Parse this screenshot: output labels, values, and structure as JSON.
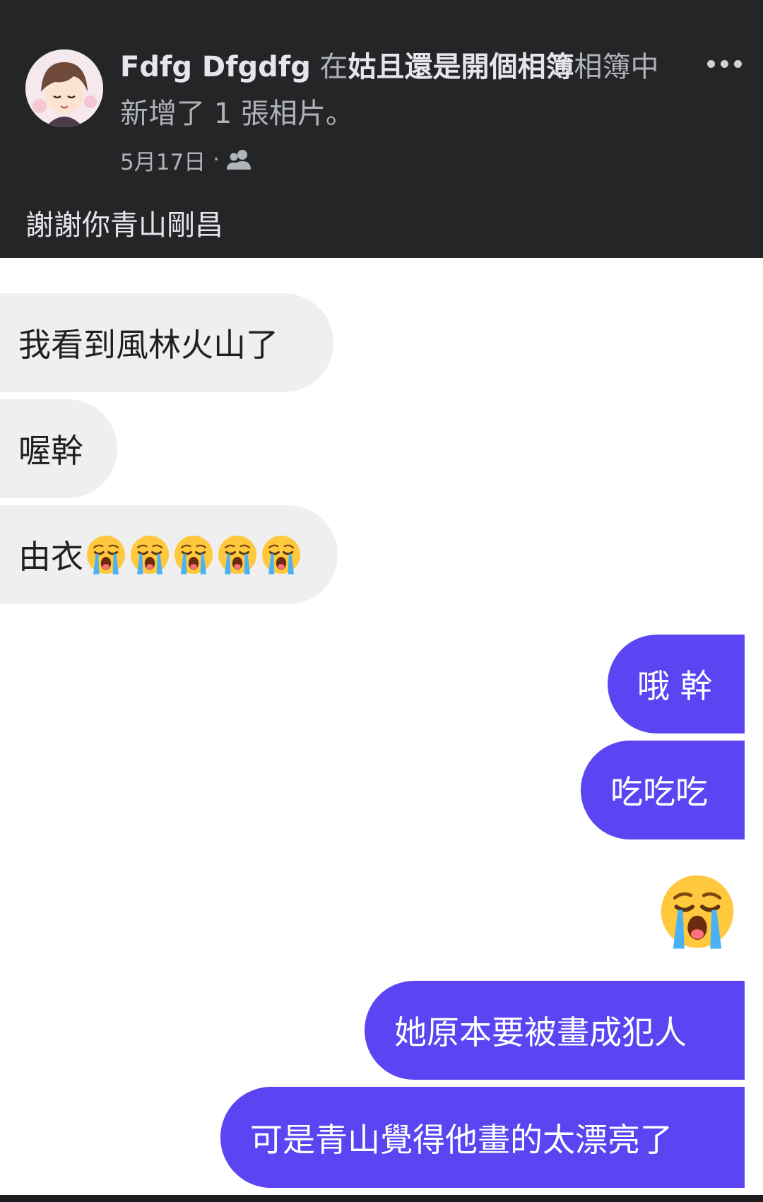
{
  "post": {
    "author_name": "Fdfg Dfgdfg",
    "action_prefix": " 在",
    "album_name": "姑且還是開個相簿",
    "action_suffix": "相簿中新增了 1 張相片。",
    "date": "5月17日",
    "separator": " · ",
    "audience_icon": "friends-icon",
    "more_icon": "more-options-icon",
    "caption": "謝謝你青山剛昌"
  },
  "chat": {
    "incoming": [
      {
        "text": "我看到風林火山了"
      },
      {
        "text": "喔幹"
      },
      {
        "text": "由衣",
        "emoji": "loudly-crying-face",
        "emoji_count": 5
      }
    ],
    "outgoing": [
      {
        "text": "哦 幹"
      },
      {
        "text": "吃吃吃"
      },
      {
        "emoji": "loudly-crying-face"
      },
      {
        "text": "她原本要被畫成犯人"
      },
      {
        "text": "可是青山覺得他畫的太漂亮了"
      }
    ]
  },
  "colors": {
    "header_bg": "#242526",
    "incoming_bubble": "#efefef",
    "outgoing_bubble": "#5b44f2"
  }
}
